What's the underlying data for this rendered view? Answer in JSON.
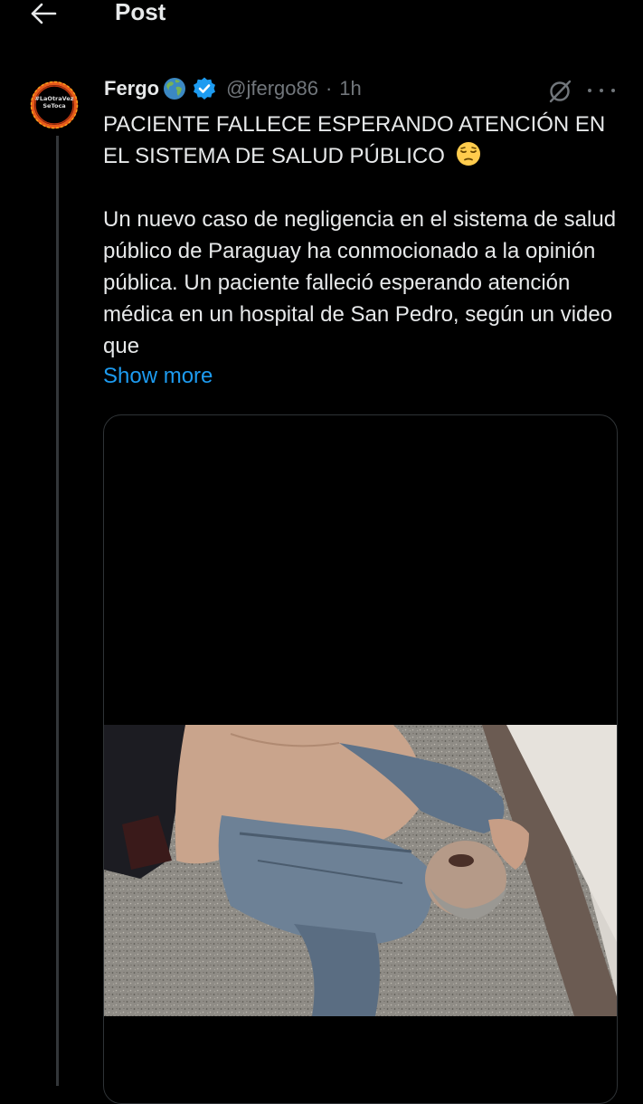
{
  "header": {
    "title": "Post",
    "back_icon": "arrow-left-icon"
  },
  "author": {
    "display_name": "Fergo",
    "globe_emoji": "🌎",
    "verified": true,
    "handle": "@jfergo86",
    "separator": "·",
    "time": "1h",
    "avatar_text_line1": "#LaOtraVez",
    "avatar_text_line2": "SeToca"
  },
  "tweet": {
    "headline_line1": "PACIENTE FALLECE ESPERANDO ATENCIÓN EN",
    "headline_line2": "EL SISTEMA DE SALUD PÚBLICO",
    "headline_emoji": "😔",
    "body": "Un nuevo caso de negligencia en el sistema de salud público de Paraguay ha conmocionado a la opinión pública. Un paciente falleció esperando atención médica en un hospital de San Pedro, según un video que",
    "show_more": "Show more"
  },
  "actions": {
    "grok_icon": "grok-slash-icon",
    "more_icon": "more-dots-icon"
  },
  "colors": {
    "background": "#000000",
    "text": "#e7e9ea",
    "muted": "#71767b",
    "link": "#1d9bf0",
    "verified": "#1d9bf0",
    "border": "#2f3336"
  }
}
